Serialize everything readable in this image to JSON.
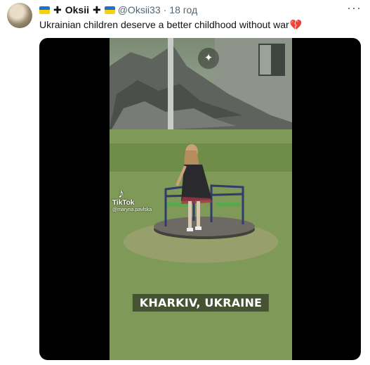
{
  "tweet": {
    "author_name": "Oksii",
    "handle": "@Oksii33",
    "separator": "·",
    "time": "18 год",
    "text": "Ukrainian children deserve a better childhood without war",
    "more_icon": "more-horizontal-icon"
  },
  "colors": {
    "flag_blue": "#1f6fd6",
    "flag_yellow": "#f5d20a",
    "heart": "#d3263b",
    "secondary_text": "#536471"
  },
  "media": {
    "caption": "KHARKIV, UKRAINE",
    "watermark_brand": "TikTok",
    "watermark_user": "@maryna.pavlska"
  }
}
